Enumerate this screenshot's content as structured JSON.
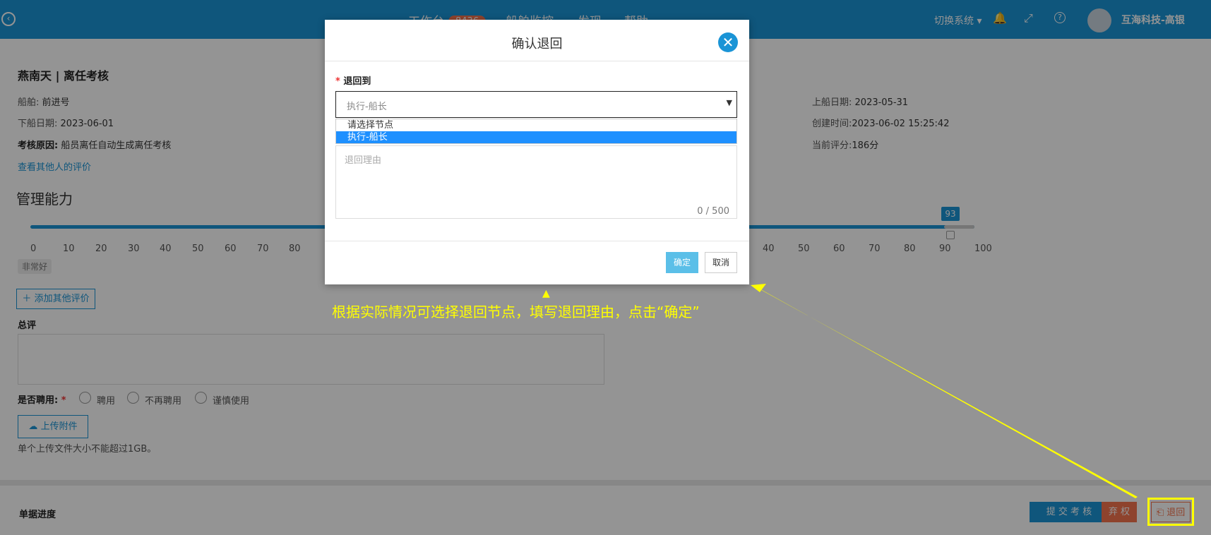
{
  "header": {
    "nav_tabs": [
      "工作台",
      "船舶监控",
      "发现",
      "帮助"
    ],
    "badge_count": "8436",
    "switch_system": "切换系统",
    "user_name": "互海科技-高银"
  },
  "record": {
    "title": "燕南天 | 离任考核",
    "ship_label": "船舶:",
    "ship_value": "前进号",
    "signoff_label": "下船日期:",
    "signoff_value": "2023-06-01",
    "reason_label": "考核原因:",
    "reason_value": "船员离任自动生成离任考核",
    "view_others_link": "查看其他人的评价",
    "signon_label": "上船日期:",
    "signon_value": "2023-05-31",
    "created_label": "创建时间:",
    "created_value": "2023-06-02 15:25:42",
    "score_label": "当前评分:",
    "score_value": "186分"
  },
  "ability": {
    "section_title": "管理能力",
    "slider_value": 93,
    "ticks_left": [
      "0",
      "10",
      "20",
      "30",
      "40",
      "50",
      "60",
      "70",
      "80"
    ],
    "ticks_right": [
      "40",
      "50",
      "60",
      "70",
      "80",
      "90",
      "100"
    ],
    "rating_badge": "非常好",
    "add_eval_button": "添加其他评价"
  },
  "summary": {
    "label": "总评",
    "hire_label": "是否聘用:",
    "hire_options": [
      "聘用",
      "不再聘用",
      "谨慎使用"
    ],
    "upload_button": "上传附件",
    "upload_hint": "单个上传文件大小不能超过1GB。"
  },
  "footer": {
    "progress_label": "单据进度",
    "submit_button": "提 交 考 核",
    "abandon_button": "弃 权",
    "return_button": "退回"
  },
  "modal": {
    "title": "确认退回",
    "field_label": "退回到",
    "selected_value": "执行-船长",
    "options": [
      "请选择节点",
      "执行-船长"
    ],
    "reason_placeholder": "退回理由",
    "char_count": "0 / 500",
    "ok_button": "确定",
    "cancel_button": "取消"
  },
  "annotation": {
    "text": "根据实际情况可选择退回节点，填写退回理由，点击“确定”"
  },
  "colors": {
    "primary": "#1a94d6",
    "highlight": "#ffff00",
    "abandon": "#f5744f"
  }
}
